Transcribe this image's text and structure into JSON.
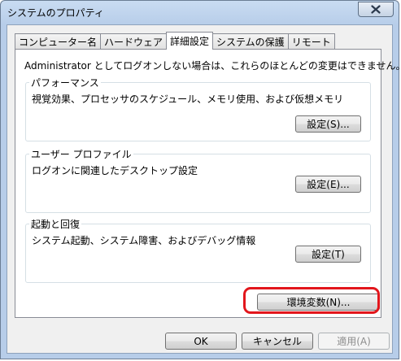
{
  "window": {
    "title": "システムのプロパティ"
  },
  "tabs": [
    {
      "label": "コンピューター名"
    },
    {
      "label": "ハードウェア"
    },
    {
      "label": "詳細設定",
      "active": true
    },
    {
      "label": "システムの保護"
    },
    {
      "label": "リモート"
    }
  ],
  "panel": {
    "intro": "Administrator としてログオンしない場合は、これらのほとんどの変更はできません。",
    "performance": {
      "title": "パフォーマンス",
      "description": "視覚効果、プロセッサのスケジュール、メモリ使用、および仮想メモリ",
      "button": "設定(S)..."
    },
    "user_profile": {
      "title": "ユーザー プロファイル",
      "description": "ログオンに関連したデスクトップ設定",
      "button": "設定(E)..."
    },
    "startup_recovery": {
      "title": "起動と回復",
      "description": "システム起動、システム障害、およびデバッグ情報",
      "button": "設定(T)"
    },
    "env_button": "環境変数(N)..."
  },
  "footer": {
    "ok": "OK",
    "cancel": "キャンセル",
    "apply": "適用(A)"
  },
  "colors": {
    "highlight": "#e2161c",
    "titlebar": "#b7cde9"
  }
}
